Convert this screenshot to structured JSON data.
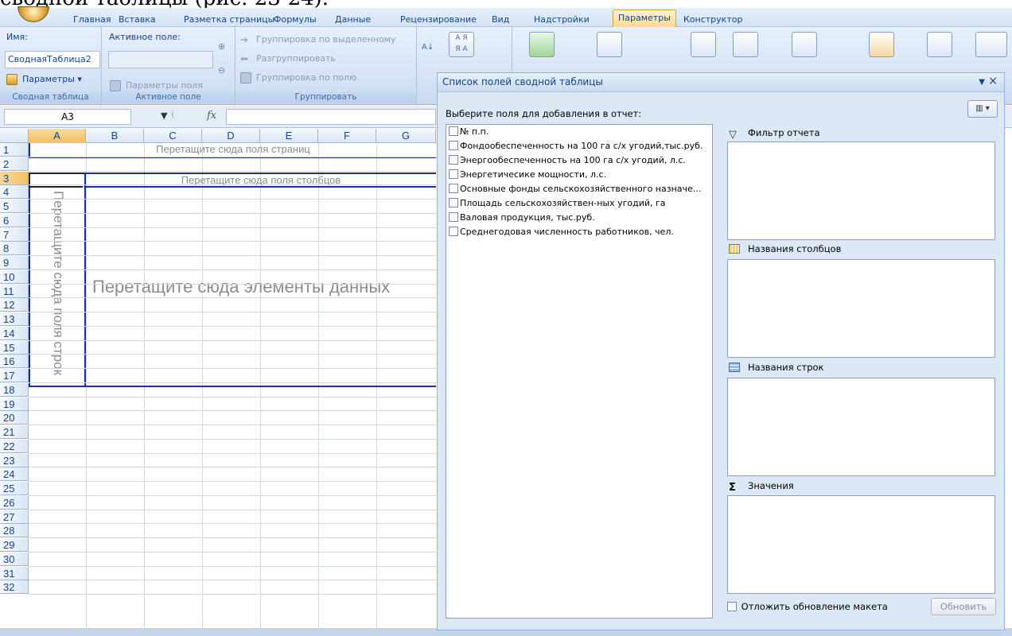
{
  "doc_caption": "сводной таблицы (рис. 23-24).",
  "tabs": [
    "Главная",
    "Вставка",
    "Разметка страницы",
    "Формулы",
    "Данные",
    "Рецензирование",
    "Вид",
    "Надстройки",
    "Параметры",
    "Конструктор"
  ],
  "active_tab": "Параметры",
  "ribbon": {
    "pivot_name_label": "Имя:",
    "pivot_name_value": "СводнаяТаблица2",
    "pivot_options_label": "Параметры",
    "group_pivot": "Сводная таблица",
    "active_field_label": "Активное поле:",
    "active_field_value": "",
    "field_settings_label": "Параметры поля",
    "group_active_field": "Активное поле",
    "group_selection": "Группировка по выделенному",
    "ungroup": "Разгруппировать",
    "group_field": "Группировка по полю",
    "group_grouping": "Группировать",
    "sort_az": "А Я",
    "sort_za": "Я А"
  },
  "formula_bar": {
    "cell_ref": "A3",
    "fx": "fx",
    "content": ""
  },
  "sheet": {
    "columns": [
      "A",
      "B",
      "C",
      "D",
      "E",
      "F",
      "G"
    ],
    "rows": [
      "1",
      "2",
      "3",
      "4",
      "5",
      "6",
      "7",
      "8",
      "9",
      "10",
      "11",
      "12",
      "13",
      "14",
      "15",
      "16",
      "17",
      "18",
      "19",
      "20",
      "21",
      "22",
      "23",
      "24",
      "25",
      "26",
      "27",
      "28",
      "29",
      "30",
      "31",
      "32"
    ],
    "selected_col": "A",
    "selected_row": "3",
    "drop_page_fields": "Перетащите сюда поля страниц",
    "drop_column_fields": "Перетащите сюда поля столбцов",
    "drop_row_fields": "Перетащите сюда поля строк",
    "drop_data_items": "Перетащите сюда элементы данных"
  },
  "pane": {
    "title": "Список полей сводной таблицы",
    "dropdown_icon": "▼",
    "close_icon": "×",
    "choose_fields_label": "Выберите поля для добавления в отчет:",
    "fields": [
      "№ п.п.",
      "Фондообеспеченность на 100 га с/х угодий,тыс.руб.",
      "Энергообеспеченность на 100 га с/х угодий, л.с.",
      "Энергетичесике мощности, л.с.",
      "Основные фонды сельскохозяйственного назначе…",
      "Площадь сельскохозяйствен-ных угодий, га",
      "Валовая продукция, тыс.руб.",
      "Среднегодовая численность работников, чел."
    ],
    "areas": {
      "report_filter": "Фильтр отчета",
      "column_labels": "Названия столбцов",
      "row_labels": "Названия строк",
      "values": "Значения"
    },
    "values_symbol": "Σ",
    "defer_update_label": "Отложить обновление макета",
    "update_button": "Обновить"
  },
  "colors": {
    "ribbon_bg": "#d4e2f5",
    "accent": "#15428b",
    "drop_border": "#1c2f9e",
    "active_tab": "#ffd98a"
  }
}
